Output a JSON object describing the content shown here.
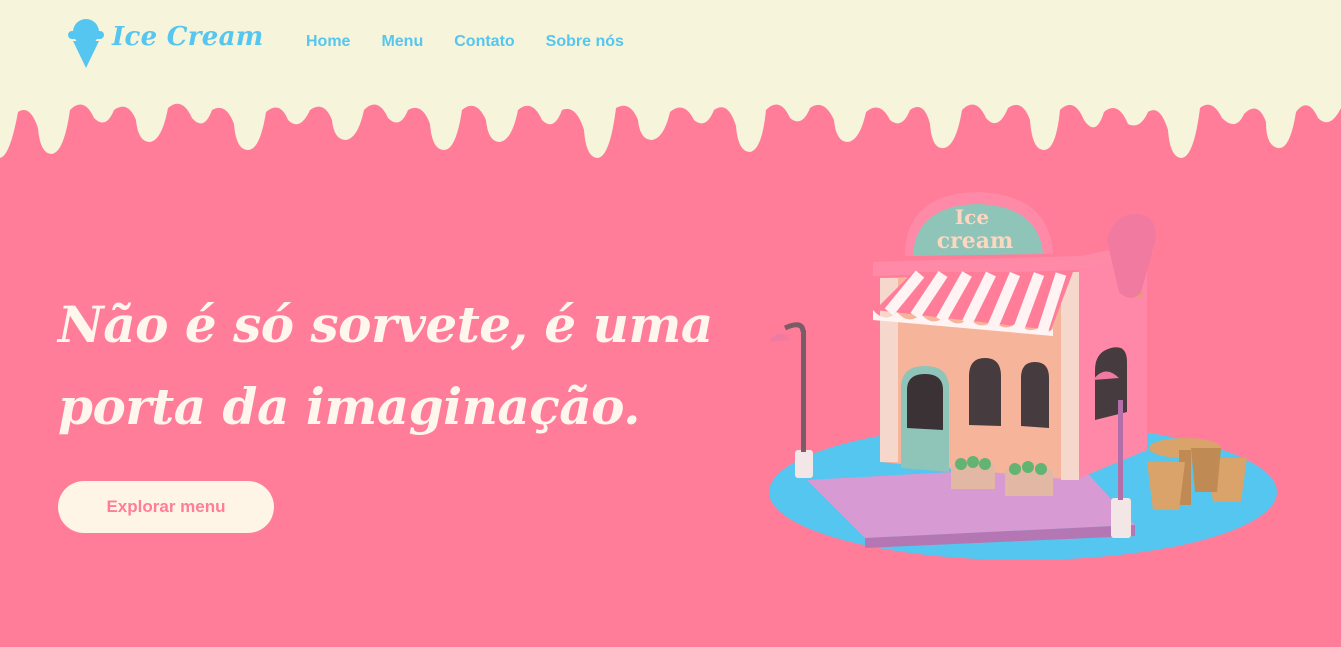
{
  "brand": {
    "name": "Ice Cream",
    "icon": "ice-cream-icon"
  },
  "nav": {
    "items": [
      "Home",
      "Menu",
      "Contato",
      "Sobre nós"
    ]
  },
  "hero": {
    "title": "Não é só sorvete, é uma porta da imaginação.",
    "cta_label": "Explorar menu"
  },
  "shop_sign": {
    "line1": "Ice",
    "line2": "cream"
  },
  "colors": {
    "background": "#ff7d99",
    "cream": "#f7f4dc",
    "accent": "#55c6ef",
    "button_bg": "#fff5e6",
    "button_text": "#ff7d99"
  }
}
